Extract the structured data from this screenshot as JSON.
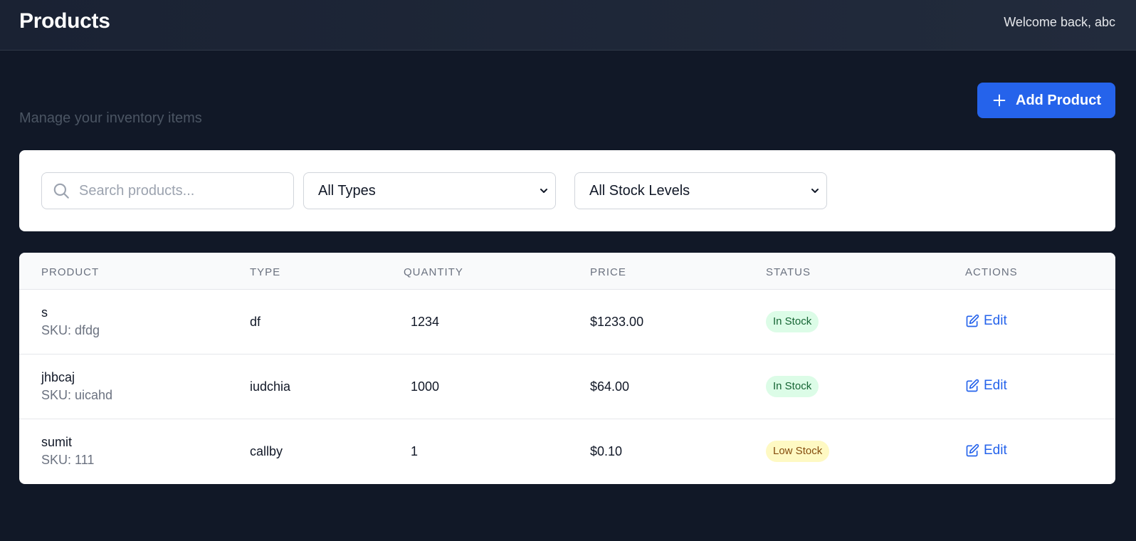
{
  "header": {
    "title": "Products",
    "welcome": "Welcome back, abc"
  },
  "page": {
    "subtitle": "Manage your inventory items",
    "add_button_label": "Add Product"
  },
  "filters": {
    "search_placeholder": "Search products...",
    "search_value": "",
    "type_selected": "All Types",
    "stock_selected": "All Stock Levels"
  },
  "table": {
    "columns": [
      "PRODUCT",
      "TYPE",
      "QUANTITY",
      "PRICE",
      "STATUS",
      "ACTIONS"
    ],
    "rows": [
      {
        "name": "s",
        "sku": "SKU: dfdg",
        "type": "df",
        "quantity": "1234",
        "price": "$1233.00",
        "status": "In Stock",
        "action": "Edit"
      },
      {
        "name": "jhbcaj",
        "sku": "SKU: uicahd",
        "type": "iudchia",
        "quantity": "1000",
        "price": "$64.00",
        "status": "In Stock",
        "action": "Edit"
      },
      {
        "name": "sumit",
        "sku": "SKU: 111",
        "type": "callby",
        "quantity": "1",
        "price": "$0.10",
        "status": "Low Stock",
        "action": "Edit"
      }
    ]
  },
  "colors": {
    "background": "#111827",
    "accent": "#2563eb",
    "in_stock_bg": "#dcfce7",
    "in_stock_text": "#166534",
    "low_stock_bg": "#fef9c3",
    "low_stock_text": "#854d0e"
  },
  "icons": {
    "add": "plus-icon",
    "search": "search-icon",
    "select": "chevron-down-icon",
    "edit": "edit-icon"
  }
}
